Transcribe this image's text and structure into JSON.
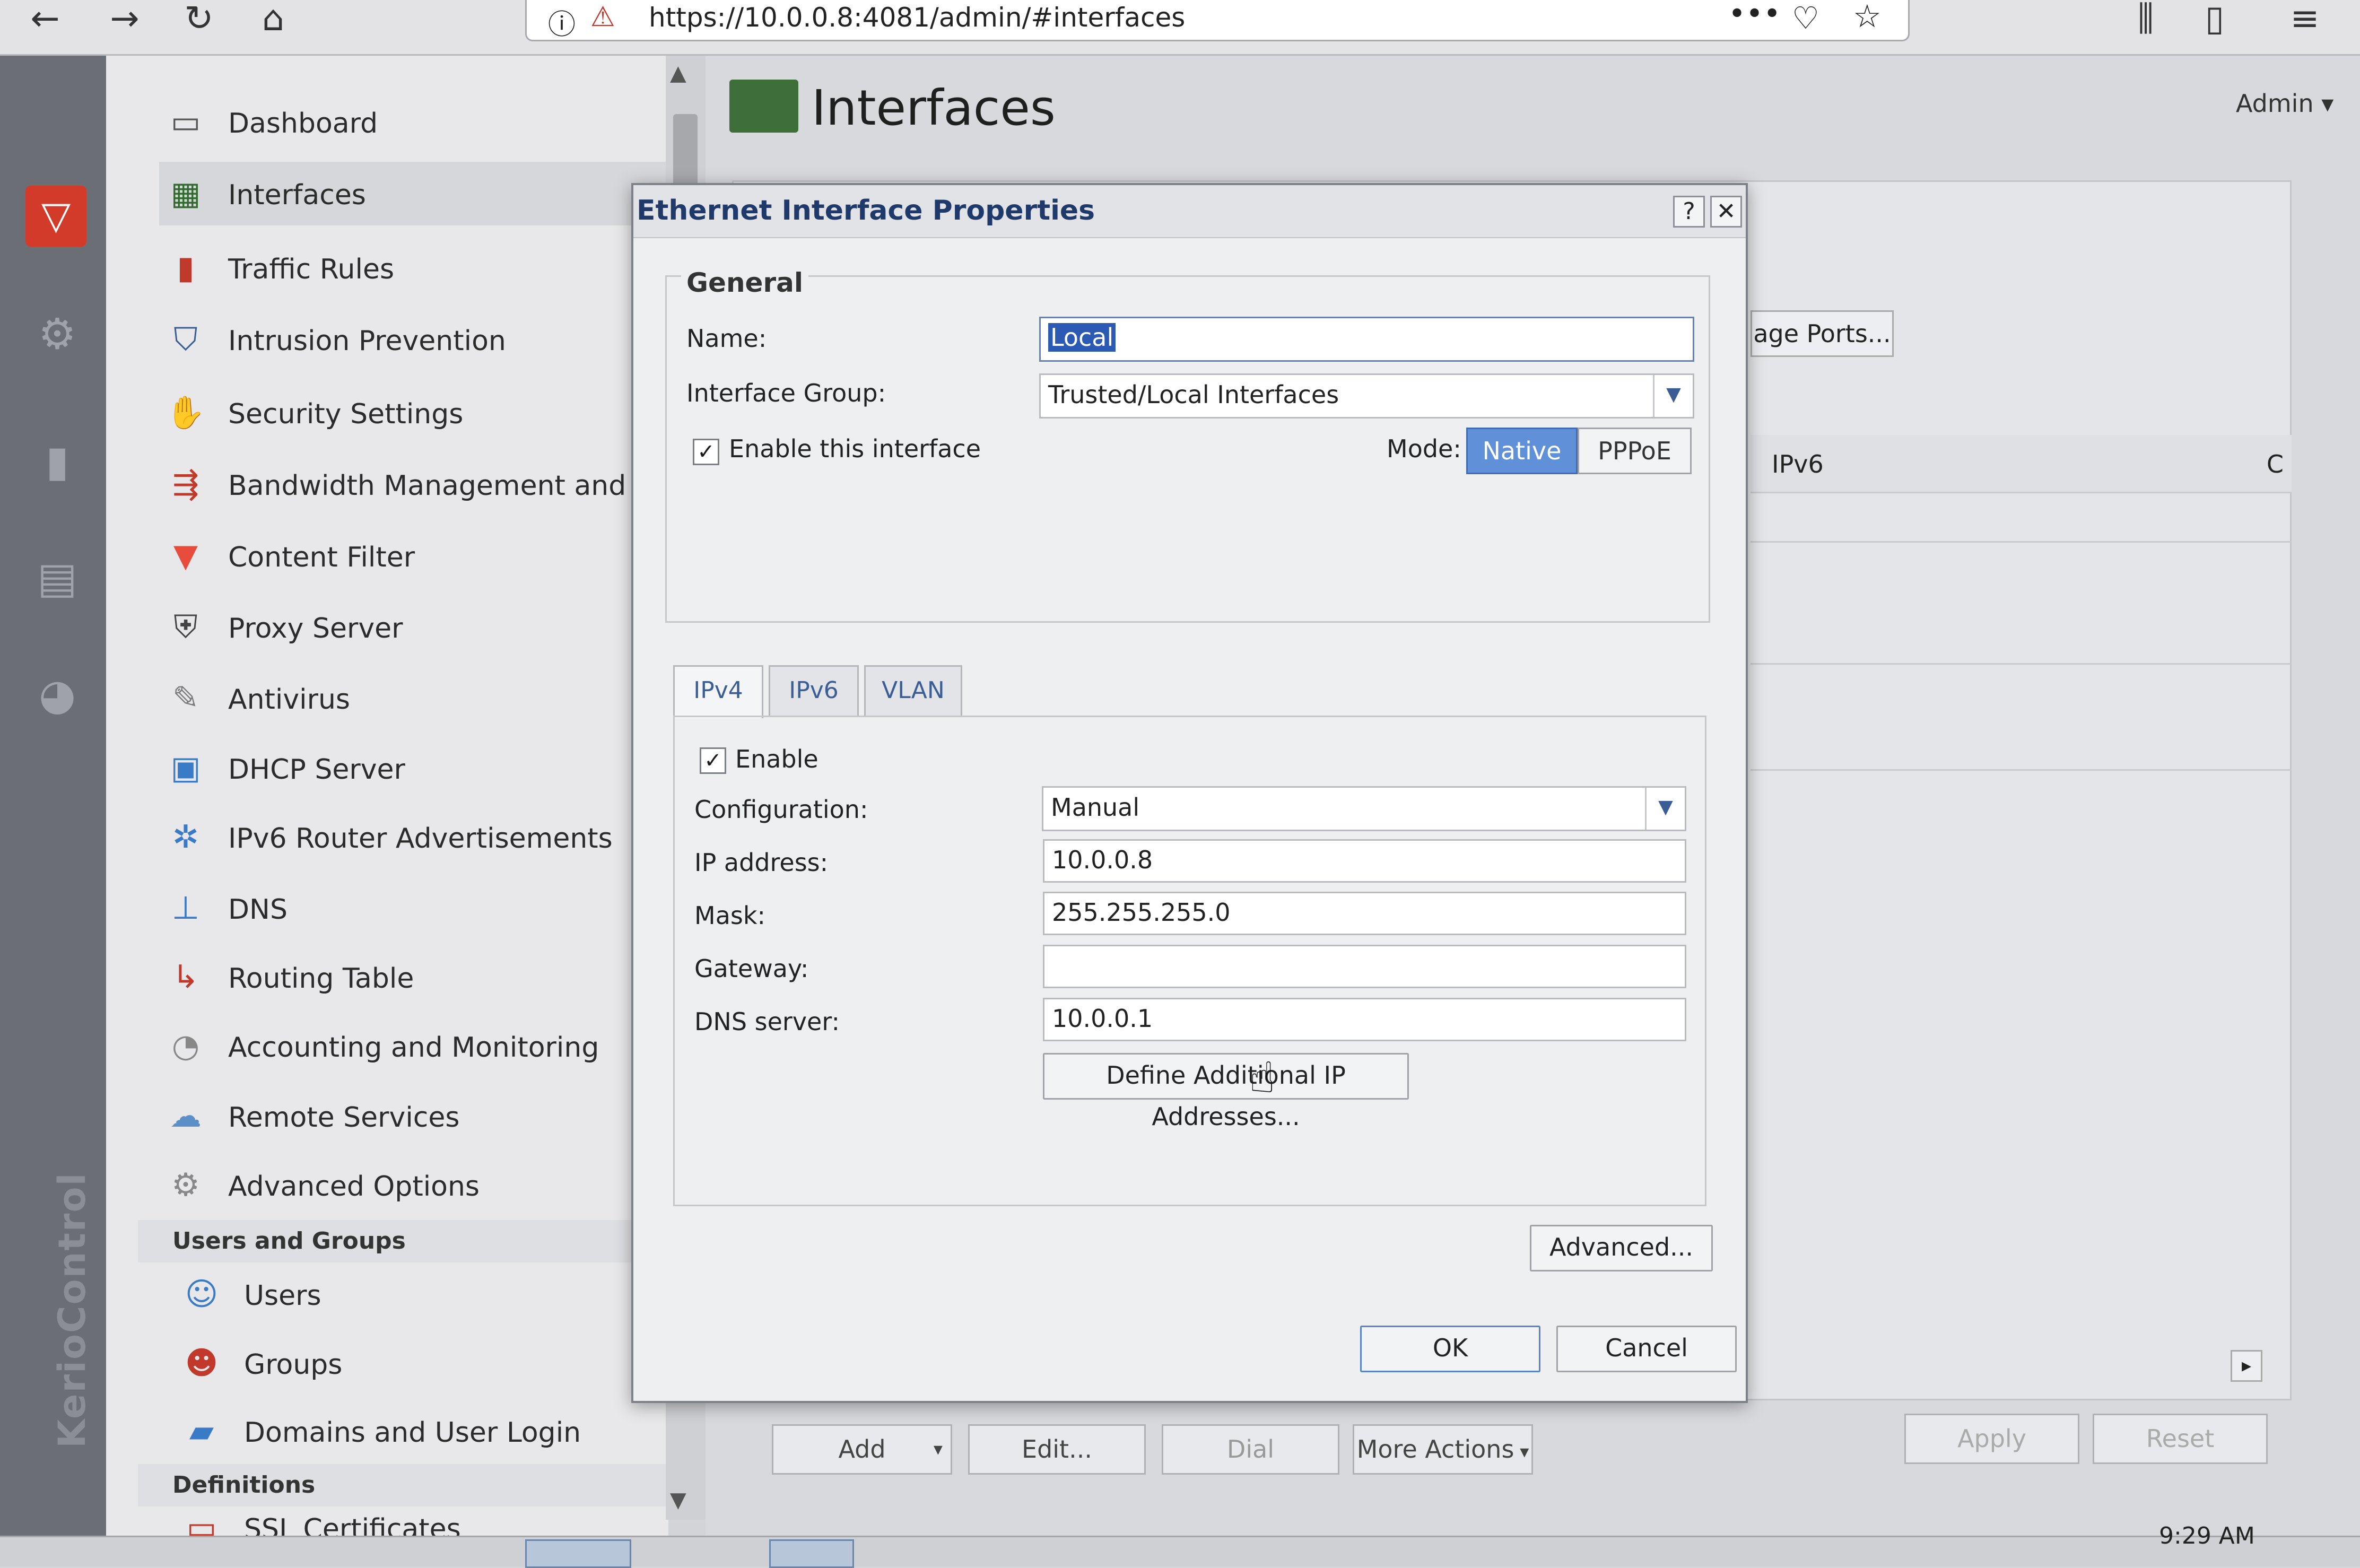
{
  "browser": {
    "url": "https://10.0.0.8:4081/admin/#interfaces",
    "icons": [
      "back-arrow-icon",
      "forward-arrow-icon",
      "reload-icon",
      "home-icon",
      "info-icon",
      "warning-lock-icon",
      "more-icon",
      "pocket-icon",
      "bookmark-star-icon",
      "library-icon",
      "sidebar-icon",
      "menu-icon"
    ]
  },
  "app": {
    "brand": "KerioControl",
    "user_menu": "Admin",
    "page_title": "Interfaces"
  },
  "sidebar": {
    "items": [
      {
        "label": "Dashboard",
        "icon": "dashboard-icon"
      },
      {
        "label": "Interfaces",
        "icon": "network-card-icon",
        "active": true
      },
      {
        "label": "Traffic Rules",
        "icon": "traffic-light-icon"
      },
      {
        "label": "Intrusion Prevention",
        "icon": "shield-icon"
      },
      {
        "label": "Security Settings",
        "icon": "stop-hand-icon"
      },
      {
        "label": "Bandwidth Management and Q",
        "icon": "bandwidth-icon"
      },
      {
        "label": "Content Filter",
        "icon": "funnel-icon"
      },
      {
        "label": "Proxy Server",
        "icon": "proxy-icon"
      },
      {
        "label": "Antivirus",
        "icon": "antivirus-icon"
      },
      {
        "label": "DHCP Server",
        "icon": "monitor-icon"
      },
      {
        "label": "IPv6 Router Advertisements",
        "icon": "router-icon"
      },
      {
        "label": "DNS",
        "icon": "dns-tree-icon"
      },
      {
        "label": "Routing Table",
        "icon": "routing-icon"
      },
      {
        "label": "Accounting and Monitoring",
        "icon": "monitoring-icon"
      },
      {
        "label": "Remote Services",
        "icon": "cloud-icon"
      },
      {
        "label": "Advanced Options",
        "icon": "gears-icon"
      }
    ],
    "users_section": "Users and Groups",
    "user_items": [
      {
        "label": "Users",
        "icon": "user-icon"
      },
      {
        "label": "Groups",
        "icon": "group-icon"
      },
      {
        "label": "Domains and User Login",
        "icon": "domain-icon"
      }
    ],
    "definitions_section": "Definitions",
    "definition_items": [
      {
        "label": "SSL Certificates",
        "icon": "certificate-icon"
      }
    ]
  },
  "main": {
    "bg_button": "age Ports...",
    "column_header": "IPv6",
    "column_header_2": "C",
    "bottom_buttons": {
      "add": "Add",
      "edit": "Edit...",
      "dial": "Dial",
      "more_actions": "More Actions",
      "apply": "Apply",
      "reset": "Reset"
    }
  },
  "dialog": {
    "title": "Ethernet Interface Properties",
    "help": "?",
    "close": "✕",
    "general": {
      "legend": "General",
      "name_label": "Name:",
      "name_value": "Local",
      "group_label": "Interface Group:",
      "group_value": "Trusted/Local Interfaces",
      "enable_label": "Enable this interface",
      "enable_checked": true,
      "mode_label": "Mode:",
      "mode_options": [
        "Native",
        "PPPoE"
      ],
      "mode_selected": "Native"
    },
    "tabs": [
      "IPv4",
      "IPv6",
      "VLAN"
    ],
    "active_tab": "IPv4",
    "ipv4": {
      "enable_label": "Enable",
      "enable_checked": true,
      "config_label": "Configuration:",
      "config_value": "Manual",
      "ip_label": "IP address:",
      "ip_value": "10.0.0.8",
      "mask_label": "Mask:",
      "mask_value": "255.255.255.0",
      "gateway_label": "Gateway:",
      "gateway_value": "",
      "dns_label": "DNS server:",
      "dns_value": "10.0.0.1",
      "define_button": "Define Additional IP Addresses..."
    },
    "advanced_button": "Advanced...",
    "ok_button": "OK",
    "cancel_button": "Cancel"
  },
  "taskbar": {
    "time": "9:29 AM"
  }
}
